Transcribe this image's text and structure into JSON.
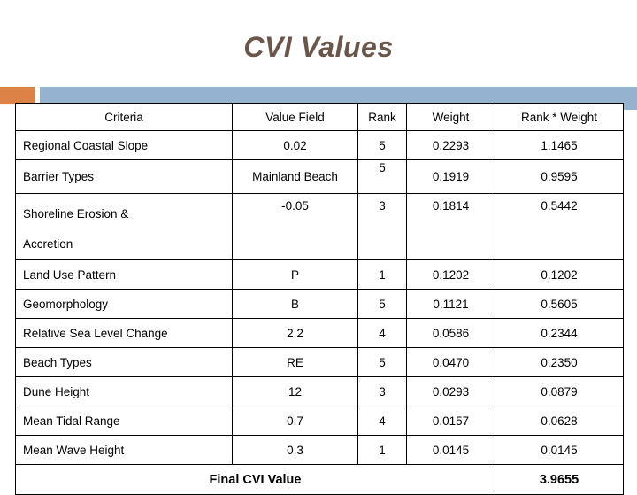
{
  "slide": {
    "title": "CVI Values",
    "title_color": "#6b564b",
    "accent_orange": "#dd8247",
    "accent_blue": "#95b3d1"
  },
  "table": {
    "columns": [
      "Criteria",
      "Value Field",
      "Rank",
      "Weight",
      "Rank * Weight"
    ],
    "rows": [
      {
        "criteria": "Regional Coastal Slope",
        "criteria_line2": "",
        "value_field": "0.02",
        "rank": "5",
        "weight": "0.2293",
        "rank_weight": "1.1465"
      },
      {
        "criteria": "Barrier Types",
        "criteria_line2": "",
        "value_field": "Mainland Beach",
        "rank": "5",
        "weight": "0.1919",
        "rank_weight": "0.9595"
      },
      {
        "criteria": "Shoreline Erosion &",
        "criteria_line2": "Accretion",
        "value_field": "-0.05",
        "rank": "3",
        "weight": "0.1814",
        "rank_weight": "0.5442"
      },
      {
        "criteria": "Land Use Pattern",
        "criteria_line2": "",
        "value_field": "P",
        "rank": "1",
        "weight": "0.1202",
        "rank_weight": "0.1202"
      },
      {
        "criteria": "Geomorphology",
        "criteria_line2": "",
        "value_field": "B",
        "rank": "5",
        "weight": "0.1121",
        "rank_weight": "0.5605"
      },
      {
        "criteria": "Relative Sea Level Change",
        "criteria_line2": "",
        "value_field": "2.2",
        "rank": "4",
        "weight": "0.0586",
        "rank_weight": "0.2344"
      },
      {
        "criteria": "Beach Types",
        "criteria_line2": "",
        "value_field": "RE",
        "rank": "5",
        "weight": "0.0470",
        "rank_weight": "0.2350"
      },
      {
        "criteria": "Dune Height",
        "criteria_line2": "",
        "value_field": "12",
        "rank": "3",
        "weight": "0.0293",
        "rank_weight": "0.0879"
      },
      {
        "criteria": "Mean Tidal Range",
        "criteria_line2": "",
        "value_field": "0.7",
        "rank": "4",
        "weight": "0.0157",
        "rank_weight": "0.0628"
      },
      {
        "criteria": "Mean Wave Height",
        "criteria_line2": "",
        "value_field": "0.3",
        "rank": "1",
        "weight": "0.0145",
        "rank_weight": "0.0145"
      }
    ],
    "total_label": "Final CVI Value",
    "total_value": "3.9655"
  }
}
